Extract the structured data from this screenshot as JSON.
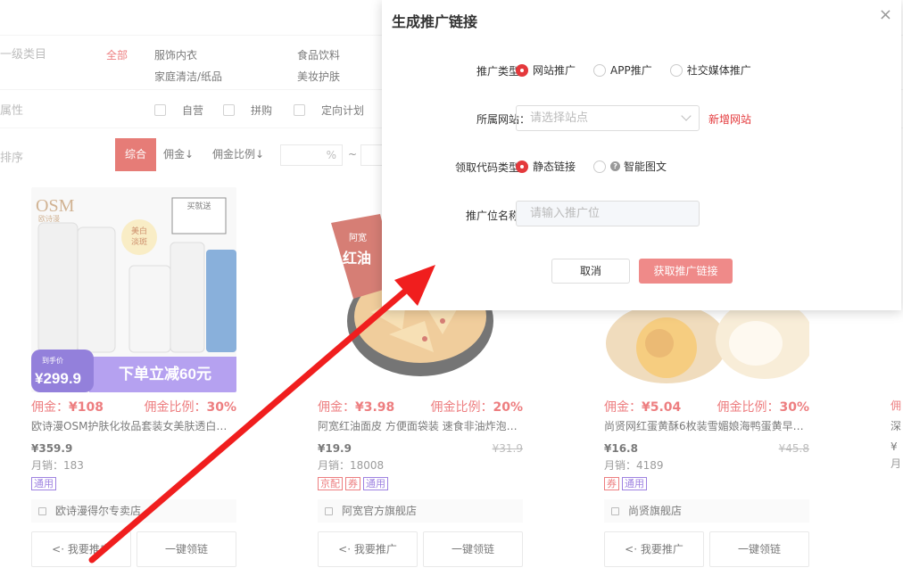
{
  "filters": {
    "category_label": "一级类目",
    "categories": [
      "全部",
      "服饰内衣",
      "食品饮料",
      "家庭清洁/纸品",
      "美妆护肤"
    ],
    "attr_label": "属性",
    "attrs": [
      "自营",
      "拼购",
      "定向计划"
    ],
    "sort_label": "排序",
    "sorts": [
      "综合",
      "佣金↓",
      "佣金比例↓"
    ],
    "pct_unit": "%",
    "tilde": "~"
  },
  "products": [
    {
      "commission_label": "佣金：",
      "commission": "¥108",
      "ratio_label": "佣金比例：",
      "ratio": "30%",
      "title": "欧诗漫OSM护肤化妆品套装女美肤透白…",
      "price": "¥359.9",
      "orig_price": "",
      "sales": "月销：183",
      "tags": [
        {
          "text": "通用",
          "color": "purple"
        }
      ],
      "shop": "欧诗漫得尔专卖店",
      "btn_share": "我要推广",
      "btn_link": "一键领链",
      "img": {
        "brand": "OSM",
        "brand_cn": "欧诗漫",
        "promo": "到手价",
        "promo_price": "¥299.9",
        "banner": "下单立减60元",
        "badge": "美白淡斑",
        "gift": "买就送"
      }
    },
    {
      "commission_label": "佣金：",
      "commission": "¥3.98",
      "ratio_label": "佣金比例：",
      "ratio": "20%",
      "title": "阿宽红油面皮 方便面袋装 速食非油炸泡…",
      "price": "¥19.9",
      "orig_price": "¥31.9",
      "sales": "月销：18008",
      "tags": [
        {
          "text": "京配",
          "color": "red"
        },
        {
          "text": "券",
          "color": "red"
        },
        {
          "text": "通用",
          "color": "purple"
        }
      ],
      "shop": "阿宽官方旗舰店",
      "btn_share": "我要推广",
      "btn_link": "一键领链",
      "img": {
        "brand": "阿宽",
        "product": "红油面皮"
      }
    },
    {
      "commission_label": "佣金：",
      "commission": "¥5.04",
      "ratio_label": "佣金比例：",
      "ratio": "30%",
      "title": "尚贤网红蛋黄酥6枚装雪媚娘海鸭蛋黄早…",
      "price": "¥16.8",
      "orig_price": "¥45.8",
      "sales": "月销：4189",
      "tags": [
        {
          "text": "券",
          "color": "red"
        },
        {
          "text": "通用",
          "color": "purple"
        }
      ],
      "shop": "尚贤旗舰店",
      "btn_share": "我要推广",
      "btn_link": "一键领链",
      "img": {}
    }
  ],
  "partial_card": {
    "commission_label": "佣",
    "title": "深",
    "price": "¥",
    "sales": "月"
  },
  "dialog": {
    "title": "生成推广链接",
    "close": "×",
    "promo_type_label": "推广类型：",
    "promo_types": [
      "网站推广",
      "APP推广",
      "社交媒体推广"
    ],
    "site_label": "所属网站：",
    "site_placeholder": "请选择站点",
    "add_site": "新增网站",
    "code_type_label": "领取代码类型：",
    "code_types": [
      "静态链接",
      "智能图文"
    ],
    "position_label": "推广位名称：",
    "position_placeholder": "请输入推广位",
    "cancel": "取消",
    "submit": "获取推广链接"
  },
  "colors": {
    "accent": "#e4393c",
    "primary_disabled": "#ef8a89",
    "tag_purple": "#6b3fd1"
  }
}
